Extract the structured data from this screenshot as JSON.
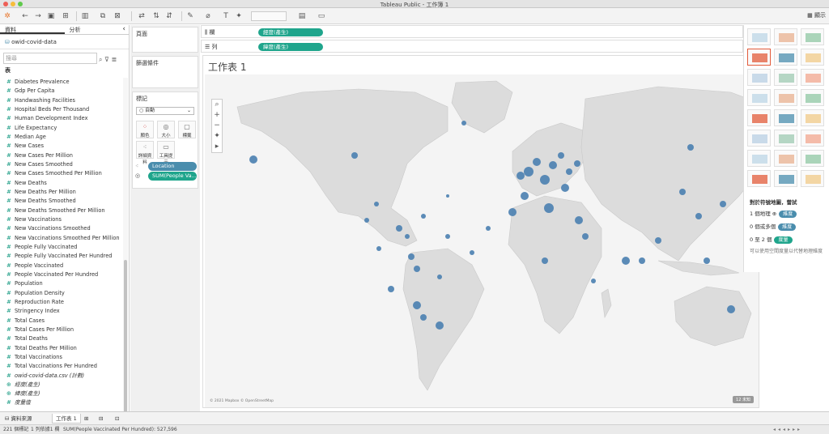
{
  "app_title": "Tableau Public - 工作簿 1",
  "toolbar": {
    "show_me_label": "顯示"
  },
  "left_tabs": [
    "資料",
    "分析"
  ],
  "data_source": "owid-covid-data",
  "search_placeholder": "搜尋",
  "table_header": "表",
  "fields": [
    {
      "name": "Diabetes Prevalence",
      "type": "measure"
    },
    {
      "name": "Gdp Per Capita",
      "type": "measure"
    },
    {
      "name": "Handwashing Facilities",
      "type": "measure"
    },
    {
      "name": "Hospital Beds Per Thousand",
      "type": "measure"
    },
    {
      "name": "Human Development Index",
      "type": "measure"
    },
    {
      "name": "Life Expectancy",
      "type": "measure"
    },
    {
      "name": "Median Age",
      "type": "measure"
    },
    {
      "name": "New Cases",
      "type": "measure"
    },
    {
      "name": "New Cases Per Million",
      "type": "measure"
    },
    {
      "name": "New Cases Smoothed",
      "type": "measure"
    },
    {
      "name": "New Cases Smoothed Per Million",
      "type": "measure"
    },
    {
      "name": "New Deaths",
      "type": "measure"
    },
    {
      "name": "New Deaths Per Million",
      "type": "measure"
    },
    {
      "name": "New Deaths Smoothed",
      "type": "measure"
    },
    {
      "name": "New Deaths Smoothed Per Million",
      "type": "measure"
    },
    {
      "name": "New Vaccinations",
      "type": "measure"
    },
    {
      "name": "New Vaccinations Smoothed",
      "type": "measure"
    },
    {
      "name": "New Vaccinations Smoothed Per Million",
      "type": "measure"
    },
    {
      "name": "People Fully Vaccinated",
      "type": "measure"
    },
    {
      "name": "People Fully Vaccinated Per Hundred",
      "type": "measure"
    },
    {
      "name": "People Vaccinated",
      "type": "measure"
    },
    {
      "name": "People Vaccinated Per Hundred",
      "type": "measure"
    },
    {
      "name": "Population",
      "type": "measure"
    },
    {
      "name": "Population Density",
      "type": "measure"
    },
    {
      "name": "Reproduction Rate",
      "type": "measure"
    },
    {
      "name": "Stringency Index",
      "type": "measure"
    },
    {
      "name": "Total Cases",
      "type": "measure"
    },
    {
      "name": "Total Cases Per Million",
      "type": "measure"
    },
    {
      "name": "Total Deaths",
      "type": "measure"
    },
    {
      "name": "Total Deaths Per Million",
      "type": "measure"
    },
    {
      "name": "Total Vaccinations",
      "type": "measure"
    },
    {
      "name": "Total Vaccinations Per Hundred",
      "type": "measure"
    },
    {
      "name": "owid-covid-data.csv (計數)",
      "type": "count"
    },
    {
      "name": "經度(產生)",
      "type": "geo"
    },
    {
      "name": "緯度(產生)",
      "type": "geo"
    },
    {
      "name": "度量值",
      "type": "measure-values"
    }
  ],
  "pages_label": "頁面",
  "filters_label": "篩選條件",
  "marks": {
    "title": "標記",
    "type": "自動",
    "buttons": [
      "顏色",
      "大小",
      "標籤",
      "詳細資料",
      "工具提示"
    ],
    "pills": [
      {
        "label": "Location",
        "color": "#4a8dad"
      },
      {
        "label": "SUM(People Va...",
        "color": "#1fa58c"
      }
    ]
  },
  "shelves": {
    "columns": {
      "label": "欄",
      "pill": "經度(產生)"
    },
    "rows": {
      "label": "列",
      "pill": "緯度(產生)"
    }
  },
  "worksheet_title": "工作表 1",
  "map": {
    "attribution": "© 2021 Mapbox © OpenStreetMap",
    "marks_badge": "12 未知"
  },
  "show_me": {
    "hint_title": "對於符號地圖，嘗試",
    "rows": [
      {
        "text": "1 個地理",
        "pill": "維度",
        "color": "#4a8dad"
      },
      {
        "text": "0 個或多個",
        "pill": "維度",
        "color": "#4a8dad"
      },
      {
        "text": "0 至 2 個",
        "pill": "度量",
        "color": "#1fa58c"
      }
    ],
    "note": "可以使用空間度量以代替地理維度"
  },
  "bottom_tabs": [
    "資料來源",
    "工作表 1"
  ],
  "status": {
    "marks": "221 個標記",
    "rows_cols": "1 列依據1 欄",
    "sum": "SUM(People Vaccinated Per Hundred): 527,596"
  }
}
